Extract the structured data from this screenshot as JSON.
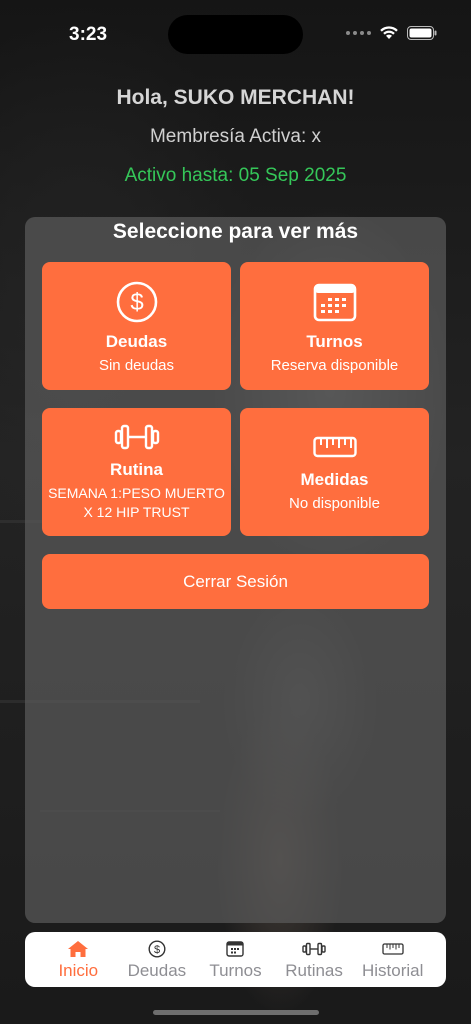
{
  "status": {
    "time": "3:23"
  },
  "header": {
    "greeting": "Hola, SUKO MERCHAN!",
    "membership": "Membresía Activa: x",
    "active_until": "Activo hasta: 05 Sep 2025"
  },
  "panel": {
    "title": "Seleccione para ver más",
    "cards": [
      {
        "title": "Deudas",
        "subtitle": "Sin deudas",
        "icon": "dollar-circle-icon"
      },
      {
        "title": "Turnos",
        "subtitle": "Reserva disponible",
        "icon": "calendar-icon"
      },
      {
        "title": "Rutina",
        "subtitle": "SEMANA 1:PESO MUERTO X 12 HIP TRUST",
        "icon": "dumbbell-icon"
      },
      {
        "title": "Medidas",
        "subtitle": "No disponible",
        "icon": "ruler-icon"
      }
    ],
    "logout_label": "Cerrar Sesión"
  },
  "tabbar": {
    "items": [
      {
        "label": "Inicio",
        "icon": "home-icon",
        "active": true
      },
      {
        "label": "Deudas",
        "icon": "dollar-circle-icon",
        "active": false
      },
      {
        "label": "Turnos",
        "icon": "calendar-icon",
        "active": false
      },
      {
        "label": "Rutinas",
        "icon": "dumbbell-icon",
        "active": false
      },
      {
        "label": "Historial",
        "icon": "ruler-icon",
        "active": false
      }
    ]
  },
  "colors": {
    "accent": "#ff6e3e",
    "active_green": "#35c759",
    "tab_inactive": "#8e8e93"
  }
}
